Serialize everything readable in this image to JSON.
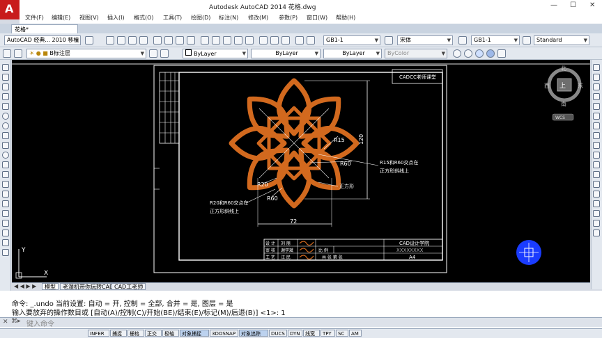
{
  "app": {
    "window_title": "Autodesk AutoCAD 2014    花格.dwg",
    "logo_letter": "A"
  },
  "menu": [
    "文件(F)",
    "编辑(E)",
    "视图(V)",
    "插入(I)",
    "格式(O)",
    "工具(T)",
    "绘图(D)",
    "标注(N)",
    "修改(M)",
    "参数(P)",
    "窗口(W)",
    "帮助(H)"
  ],
  "doc_tab": {
    "label": "花格*"
  },
  "toolbar": {
    "workspace": "AutoCAD 经典... 2010 移植",
    "text_style": "GB1-1",
    "font": "宋体",
    "dim_style": "GB1-1",
    "table_style": "Standard",
    "layer": "B标注层",
    "color": "ByLayer",
    "linetype": "ByLayer",
    "lineweight": "ByLayer",
    "plot_style": "ByColor"
  },
  "drawing": {
    "title_block_header": "CADCC老师课堂",
    "dims": {
      "r15": "R15",
      "r60a": "R60",
      "r20": "R20",
      "r60b": "R60",
      "width": "72",
      "height": "120"
    },
    "notes": {
      "note1_line1": "R15和R60交点在",
      "note1_line2": "正方形斜线上",
      "note2": "正方形",
      "note3_line1": "R20和R60交点在",
      "note3_line2": "正方形斜线上"
    },
    "title_block": {
      "school": "CAD设计学院",
      "part_no": "XXXXXXXX",
      "paper": "A4",
      "row_labels": [
        "设 计",
        "审 核",
        "工 艺"
      ],
      "row_names": [
        "刘 丽",
        "谢学斌",
        "汪 民"
      ],
      "mid_label": "比 例",
      "bottom": "共  张 第  张"
    }
  },
  "viewcube": {
    "north": "北",
    "south": "南",
    "east": "东",
    "west": "西",
    "face": "上",
    "wcs": "WCS"
  },
  "layout_tabs": [
    "模型",
    "老湿机带你玩转CAD",
    "CAD工老师"
  ],
  "command": {
    "line1": "命令:  _.undo 当前设置: 自动 = 开, 控制 = 全部, 合并 = 是, 图层 = 是",
    "line2": "输入要放弃的操作数目或 [自动(A)/控制(C)/开始(BE)/结束(E)/标记(M)/后退(B)] <1>: 1",
    "placeholder": "键入命令"
  },
  "status_buttons": [
    {
      "label": "INFER",
      "on": false
    },
    {
      "label": "捕捉",
      "on": false
    },
    {
      "label": "栅格",
      "on": false
    },
    {
      "label": "正交",
      "on": false
    },
    {
      "label": "极轴",
      "on": false
    },
    {
      "label": "对象捕捉",
      "on": true
    },
    {
      "label": "3DOSNAP",
      "on": false
    },
    {
      "label": "对象追踪",
      "on": true
    },
    {
      "label": "DUCS",
      "on": false
    },
    {
      "label": "DYN",
      "on": false
    },
    {
      "label": "线宽",
      "on": false
    },
    {
      "label": "TPY",
      "on": false
    },
    {
      "label": "SC",
      "on": false
    },
    {
      "label": "AM",
      "on": false
    }
  ],
  "colors": {
    "accent_orange": "#d2691e",
    "cursor_blue": "#1a3cff",
    "canvas_bg": "#000000"
  }
}
